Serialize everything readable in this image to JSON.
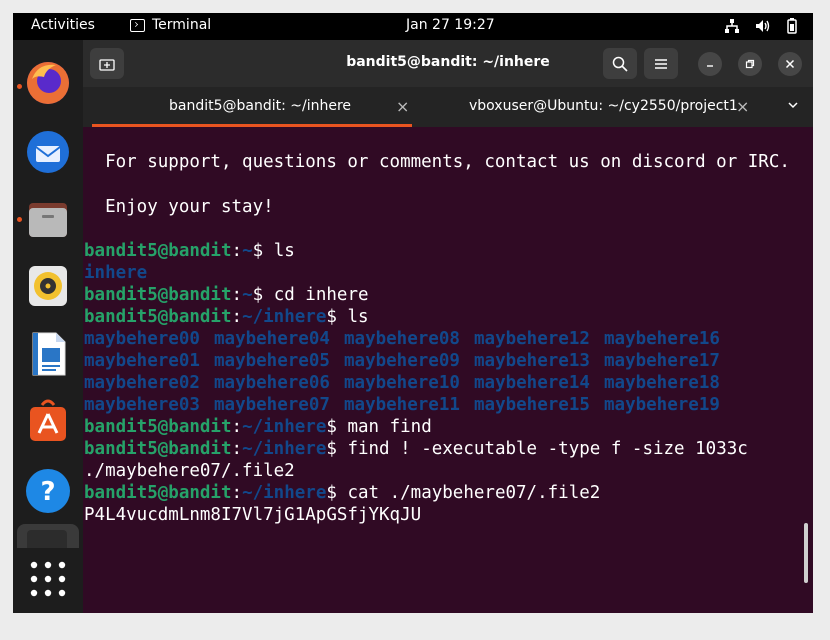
{
  "topbar": {
    "activities": "Activities",
    "app_name": "Terminal",
    "clock": "Jan 27  19:27",
    "tray_icons": [
      "network-icon",
      "volume-icon",
      "battery-icon"
    ]
  },
  "dock": {
    "items": [
      "firefox",
      "thunderbird",
      "files",
      "rhythmbox",
      "libreoffice-writer",
      "ubuntu-software",
      "help",
      "terminal",
      "show-apps"
    ]
  },
  "window": {
    "title": "bandit5@bandit: ~/inhere",
    "tabs": [
      {
        "label": "bandit5@bandit: ~/inhere",
        "active": true
      },
      {
        "label": "vboxuser@Ubuntu: ~/cy2550/project1",
        "active": false
      }
    ],
    "close_glyph": "×"
  },
  "terminal": {
    "motd_support": "  For support, questions or comments, contact us on discord or IRC.",
    "motd_enjoy": "  Enjoy your stay!",
    "prompt_user": "bandit5@bandit",
    "prompt_colon": ":",
    "path_home": "~",
    "path_inhere": "~/inhere",
    "dollar": "$ ",
    "cmd_ls": "ls",
    "out_inhere": "inhere",
    "cmd_cd": "cd inhere",
    "cmd_ls2": "ls",
    "dir_rows": [
      [
        "maybehere00",
        "maybehere04",
        "maybehere08",
        "maybehere12",
        "maybehere16"
      ],
      [
        "maybehere01",
        "maybehere05",
        "maybehere09",
        "maybehere13",
        "maybehere17"
      ],
      [
        "maybehere02",
        "maybehere06",
        "maybehere10",
        "maybehere14",
        "maybehere18"
      ],
      [
        "maybehere03",
        "maybehere07",
        "maybehere11",
        "maybehere15",
        "maybehere19"
      ]
    ],
    "cmd_man": "man find",
    "cmd_find": "find ! -executable -type f -size 1033c",
    "out_find": "./maybehere07/.file2",
    "cmd_cat": "cat ./maybehere07/.file2",
    "out_cat": "P4L4vucdmLnm8I7Vl7jG1ApGSfjYKqJU"
  },
  "colors": {
    "terminal_bg": "#300a24",
    "prompt_user": "#26a269",
    "prompt_path": "#12488b",
    "tab_accent": "#e95420"
  }
}
